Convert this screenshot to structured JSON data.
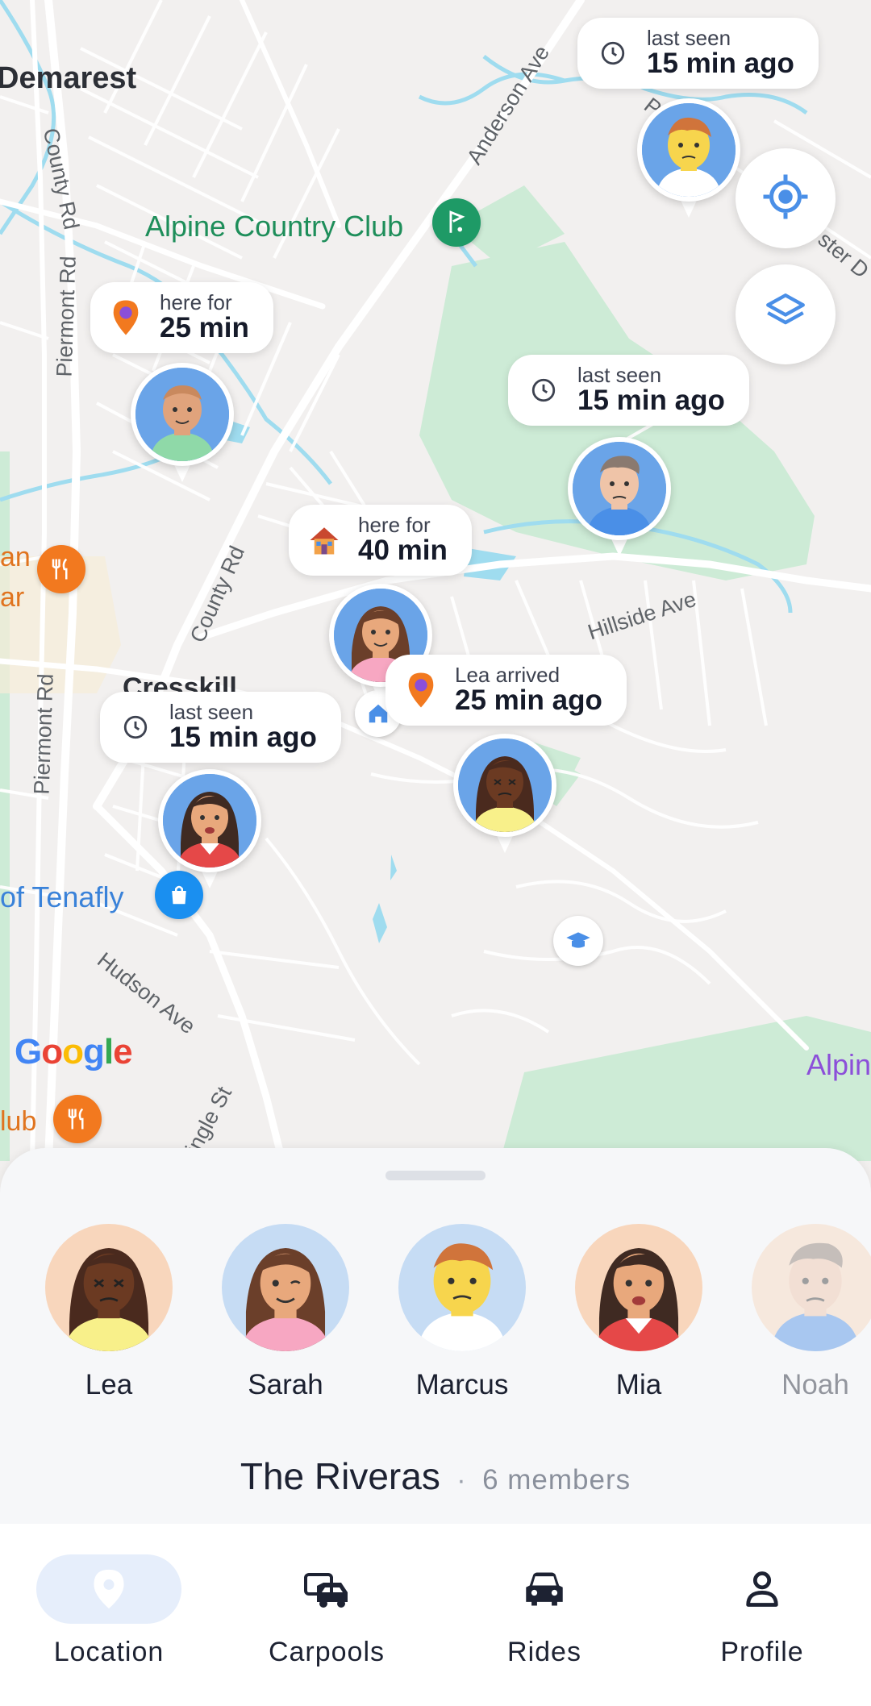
{
  "map": {
    "places": {
      "demarest": "Demarest",
      "alpine_cc": "Alpine Country Club",
      "cresskill": "Cresskill",
      "tenafly": "of Tenafly",
      "alpine_right": "Alpin",
      "club_left": "lub",
      "an_left": "an",
      "ar_left": "ar",
      "google": "Google"
    },
    "roads": {
      "anderson": "Anderson Ave",
      "county_rd_top": "County Rd",
      "piermont_top": "Piermont Rd",
      "county_rd_mid": "County Rd",
      "piermont_bottom": "Piermont Rd",
      "hillside": "Hillside Ave",
      "hudson": "Hudson Ave",
      "ingle": "ingle St",
      "ster": "ster D",
      "p_d": "P D"
    },
    "bubbles": [
      {
        "small": "last seen",
        "big": "15 min ago",
        "icon": "clock-icon"
      },
      {
        "small": "here for",
        "big": "25 min",
        "icon": "location-pin-icon"
      },
      {
        "small": "last seen",
        "big": "15 min ago",
        "icon": "clock-icon"
      },
      {
        "small": "here for",
        "big": "40 min",
        "icon": "house-icon"
      },
      {
        "small": "Lea arrived",
        "big": "25 min ago",
        "icon": "location-pin-icon"
      },
      {
        "small": "last seen",
        "big": "15 min ago",
        "icon": "clock-icon"
      }
    ]
  },
  "sheet": {
    "members": [
      {
        "name": "Lea"
      },
      {
        "name": "Sarah"
      },
      {
        "name": "Marcus"
      },
      {
        "name": "Mia"
      },
      {
        "name": "Noah"
      }
    ],
    "group_name": "The Riveras",
    "separator": "·",
    "member_count": "6 members"
  },
  "tabs": [
    {
      "label": "Location",
      "icon": "location-pin-icon",
      "active": true
    },
    {
      "label": "Carpools",
      "icon": "carpool-icon",
      "active": false
    },
    {
      "label": "Rides",
      "icon": "car-icon",
      "active": false
    },
    {
      "label": "Profile",
      "icon": "person-icon",
      "active": false
    }
  ],
  "colors": {
    "accent": "#4a8fe7",
    "park": "#cdebd6",
    "water": "#9fdcef",
    "food_poi": "#f2791f",
    "active_tab_bg": "#e6eefb"
  }
}
